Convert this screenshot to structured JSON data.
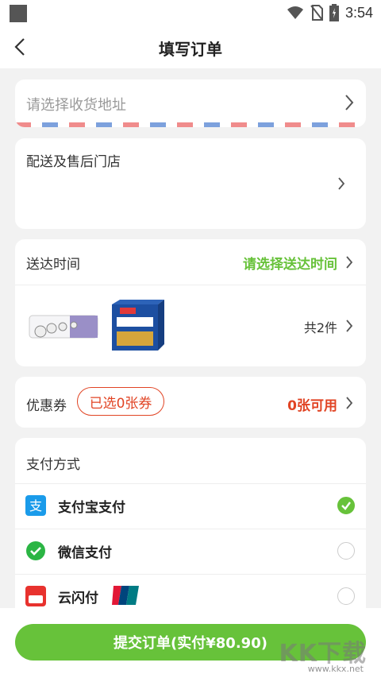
{
  "status_bar": {
    "time": "3:54"
  },
  "header": {
    "title": "填写订单"
  },
  "address": {
    "placeholder": "请选择收货地址"
  },
  "store": {
    "label": "配送及售后门店"
  },
  "delivery": {
    "label": "送达时间",
    "action": "请选择送达时间"
  },
  "goods": {
    "count_text": "共2件"
  },
  "coupon": {
    "label": "优惠券",
    "selected": "已选0张券",
    "available": "0张可用"
  },
  "payment": {
    "title": "支付方式",
    "methods": [
      {
        "label": "支付宝支付",
        "icon": "alipay-icon",
        "checked": true
      },
      {
        "label": "微信支付",
        "icon": "wechat-pay-icon",
        "checked": false
      },
      {
        "label": "云闪付",
        "icon": "quickpass-icon",
        "badge": "UnionPay 银联",
        "checked": false
      }
    ]
  },
  "submit": {
    "label": "提交订单(实付¥80.90)"
  },
  "watermark": {
    "text": "KK下载",
    "url": "www.kkx.net"
  },
  "colors": {
    "accent_green": "#67c23a",
    "accent_red": "#e14424"
  }
}
